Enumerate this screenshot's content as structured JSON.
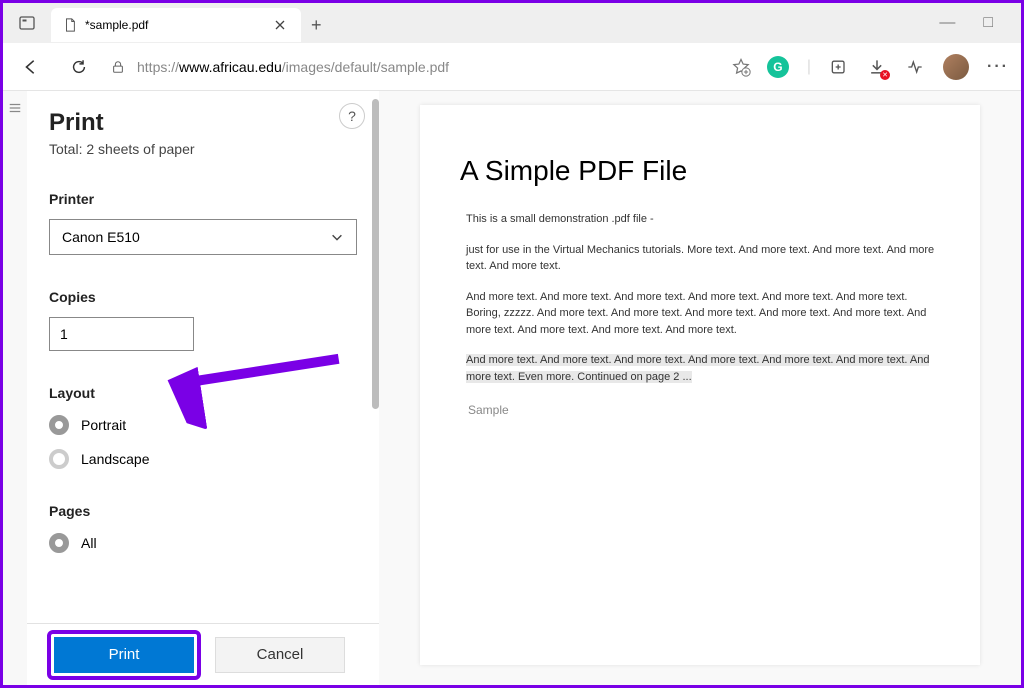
{
  "window": {
    "tab_title": "*sample.pdf",
    "min_label": "—",
    "max_label": "□",
    "close_label": "✕",
    "new_tab_label": "+"
  },
  "url": {
    "proto": "https://",
    "domain": "www.africau.edu",
    "path": "/images/default/sample.pdf"
  },
  "print": {
    "title": "Print",
    "subtitle": "Total: 2 sheets of paper",
    "help_label": "?",
    "printer_label": "Printer",
    "printer_value": "Canon E510",
    "copies_label": "Copies",
    "copies_value": "1",
    "layout_label": "Layout",
    "layout_options": {
      "portrait": "Portrait",
      "landscape": "Landscape"
    },
    "pages_label": "Pages",
    "pages_options": {
      "all": "All"
    },
    "print_btn": "Print",
    "cancel_btn": "Cancel"
  },
  "doc": {
    "heading": "A Simple PDF File",
    "p1": "This is a small demonstration .pdf file -",
    "p2": "just for use in the Virtual Mechanics tutorials. More text. And more text. And more text. And more text. And more text.",
    "p3": "And more text. And more text. And more text. And more text. And more text. And more text. Boring, zzzzz. And more text. And more text. And more text. And more text. And more text. And more text. And more text. And more text. And more text.",
    "p4": "And more text. And more text. And more text. And more text. And more text. And more text. And more text. Even more. Continued on page 2 ...",
    "sample": "Sample"
  }
}
